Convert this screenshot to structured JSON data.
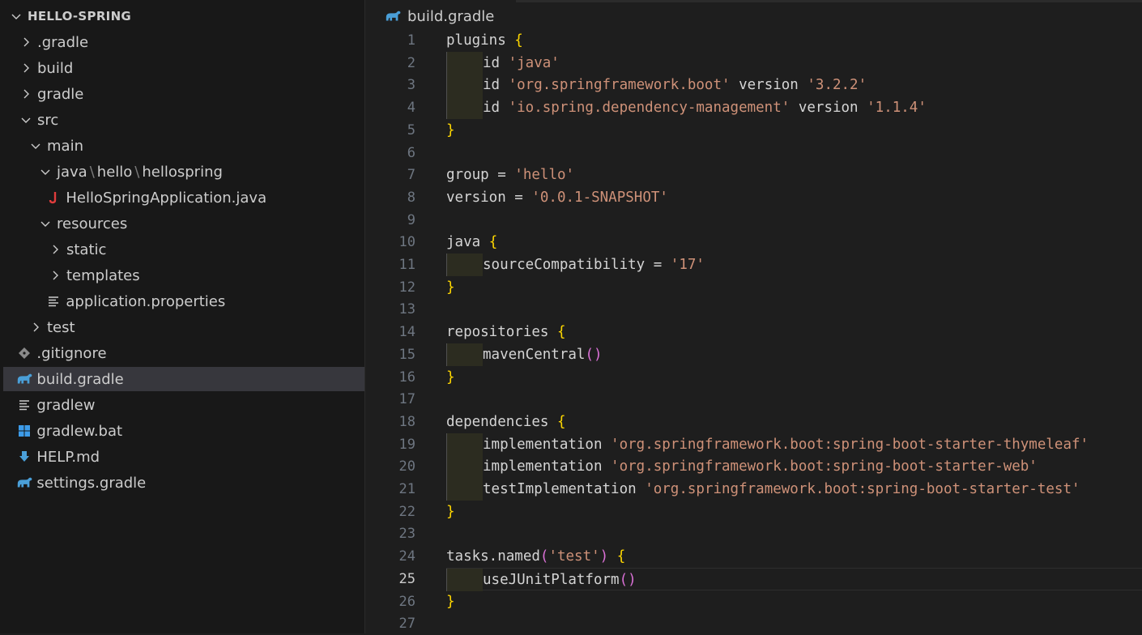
{
  "explorer": {
    "root_label": "HELLO-SPRING",
    "items": [
      {
        "label": ".gradle",
        "depth": 1,
        "kind": "folder",
        "expanded": false
      },
      {
        "label": "build",
        "depth": 1,
        "kind": "folder",
        "expanded": false
      },
      {
        "label": "gradle",
        "depth": 1,
        "kind": "folder",
        "expanded": false
      },
      {
        "label": "src",
        "depth": 1,
        "kind": "folder",
        "expanded": true
      },
      {
        "label": "main",
        "depth": 2,
        "kind": "folder",
        "expanded": true
      },
      {
        "label": "java \\ hello \\ hellospring",
        "parts": [
          "java",
          "hello",
          "hellospring"
        ],
        "depth": 3,
        "kind": "folder",
        "expanded": true
      },
      {
        "label": "HelloSpringApplication.java",
        "depth": 4,
        "kind": "file",
        "icon": "java-icon"
      },
      {
        "label": "resources",
        "depth": 3,
        "kind": "folder",
        "expanded": true
      },
      {
        "label": "static",
        "depth": 4,
        "kind": "folder",
        "expanded": false
      },
      {
        "label": "templates",
        "depth": 4,
        "kind": "folder",
        "expanded": false
      },
      {
        "label": "application.properties",
        "depth": 4,
        "kind": "file",
        "icon": "lines-icon"
      },
      {
        "label": "test",
        "depth": 2,
        "kind": "folder",
        "expanded": false
      },
      {
        "label": ".gitignore",
        "depth": 1,
        "kind": "file",
        "icon": "git-icon"
      },
      {
        "label": "build.gradle",
        "depth": 1,
        "kind": "file",
        "icon": "gradle-icon",
        "selected": true
      },
      {
        "label": "gradlew",
        "depth": 1,
        "kind": "file",
        "icon": "lines-icon"
      },
      {
        "label": "gradlew.bat",
        "depth": 1,
        "kind": "file",
        "icon": "windows-icon"
      },
      {
        "label": "HELP.md",
        "depth": 1,
        "kind": "file",
        "icon": "download-icon"
      },
      {
        "label": "settings.gradle",
        "depth": 1,
        "kind": "file",
        "icon": "gradle-icon"
      }
    ]
  },
  "editor": {
    "tab_label": "build.gradle",
    "tab_icon": "gradle-icon",
    "current_line": 25,
    "lines": [
      {
        "n": "1",
        "tokens": [
          [
            "plain",
            "plugins "
          ],
          [
            "brace",
            "{"
          ]
        ]
      },
      {
        "n": "2",
        "indent": 1,
        "tokens": [
          [
            "plain",
            "id "
          ],
          [
            "str",
            "'java'"
          ]
        ]
      },
      {
        "n": "3",
        "indent": 1,
        "tokens": [
          [
            "plain",
            "id "
          ],
          [
            "str",
            "'org.springframework.boot'"
          ],
          [
            "plain",
            " version "
          ],
          [
            "str",
            "'3.2.2'"
          ]
        ]
      },
      {
        "n": "4",
        "indent": 1,
        "tokens": [
          [
            "plain",
            "id "
          ],
          [
            "str",
            "'io.spring.dependency-management'"
          ],
          [
            "plain",
            " version "
          ],
          [
            "str",
            "'1.1.4'"
          ]
        ]
      },
      {
        "n": "5",
        "tokens": [
          [
            "brace",
            "}"
          ]
        ]
      },
      {
        "n": "6",
        "tokens": []
      },
      {
        "n": "7",
        "tokens": [
          [
            "plain",
            "group = "
          ],
          [
            "str",
            "'hello'"
          ]
        ]
      },
      {
        "n": "8",
        "tokens": [
          [
            "plain",
            "version = "
          ],
          [
            "str",
            "'0.0.1-SNAPSHOT'"
          ]
        ]
      },
      {
        "n": "9",
        "tokens": []
      },
      {
        "n": "10",
        "tokens": [
          [
            "plain",
            "java "
          ],
          [
            "brace",
            "{"
          ]
        ]
      },
      {
        "n": "11",
        "indent": 1,
        "tokens": [
          [
            "plain",
            "sourceCompatibility = "
          ],
          [
            "str",
            "'17'"
          ]
        ]
      },
      {
        "n": "12",
        "tokens": [
          [
            "brace",
            "}"
          ]
        ]
      },
      {
        "n": "13",
        "tokens": []
      },
      {
        "n": "14",
        "tokens": [
          [
            "plain",
            "repositories "
          ],
          [
            "brace",
            "{"
          ]
        ]
      },
      {
        "n": "15",
        "indent": 1,
        "tokens": [
          [
            "plain",
            "mavenCentral"
          ],
          [
            "paren",
            "()"
          ]
        ]
      },
      {
        "n": "16",
        "tokens": [
          [
            "brace",
            "}"
          ]
        ]
      },
      {
        "n": "17",
        "tokens": []
      },
      {
        "n": "18",
        "tokens": [
          [
            "plain",
            "dependencies "
          ],
          [
            "brace",
            "{"
          ]
        ]
      },
      {
        "n": "19",
        "indent": 1,
        "tokens": [
          [
            "plain",
            "implementation "
          ],
          [
            "str",
            "'org.springframework.boot:spring-boot-starter-thymeleaf'"
          ]
        ]
      },
      {
        "n": "20",
        "indent": 1,
        "tokens": [
          [
            "plain",
            "implementation "
          ],
          [
            "str",
            "'org.springframework.boot:spring-boot-starter-web'"
          ]
        ]
      },
      {
        "n": "21",
        "indent": 1,
        "tokens": [
          [
            "plain",
            "testImplementation "
          ],
          [
            "str",
            "'org.springframework.boot:spring-boot-starter-test'"
          ]
        ]
      },
      {
        "n": "22",
        "tokens": [
          [
            "brace",
            "}"
          ]
        ]
      },
      {
        "n": "23",
        "tokens": []
      },
      {
        "n": "24",
        "tokens": [
          [
            "plain",
            "tasks.named"
          ],
          [
            "paren",
            "("
          ],
          [
            "str",
            "'test'"
          ],
          [
            "paren",
            ")"
          ],
          [
            "plain",
            " "
          ],
          [
            "brace",
            "{"
          ]
        ]
      },
      {
        "n": "25",
        "indent": 1,
        "tokens": [
          [
            "plain",
            "useJUnitPlatform"
          ],
          [
            "paren",
            "()"
          ]
        ]
      },
      {
        "n": "26",
        "tokens": [
          [
            "brace",
            "}"
          ]
        ]
      },
      {
        "n": "27",
        "tokens": []
      }
    ]
  },
  "colors": {
    "string": "#ce9178",
    "brace": "#ffd700",
    "paren": "#da70d6",
    "java_icon": "#e03c3c",
    "gradle_icon": "#4a9fd8",
    "windows_icon": "#3d9be9",
    "download_icon": "#4a9fd8",
    "git_icon": "#8a8a8a"
  }
}
